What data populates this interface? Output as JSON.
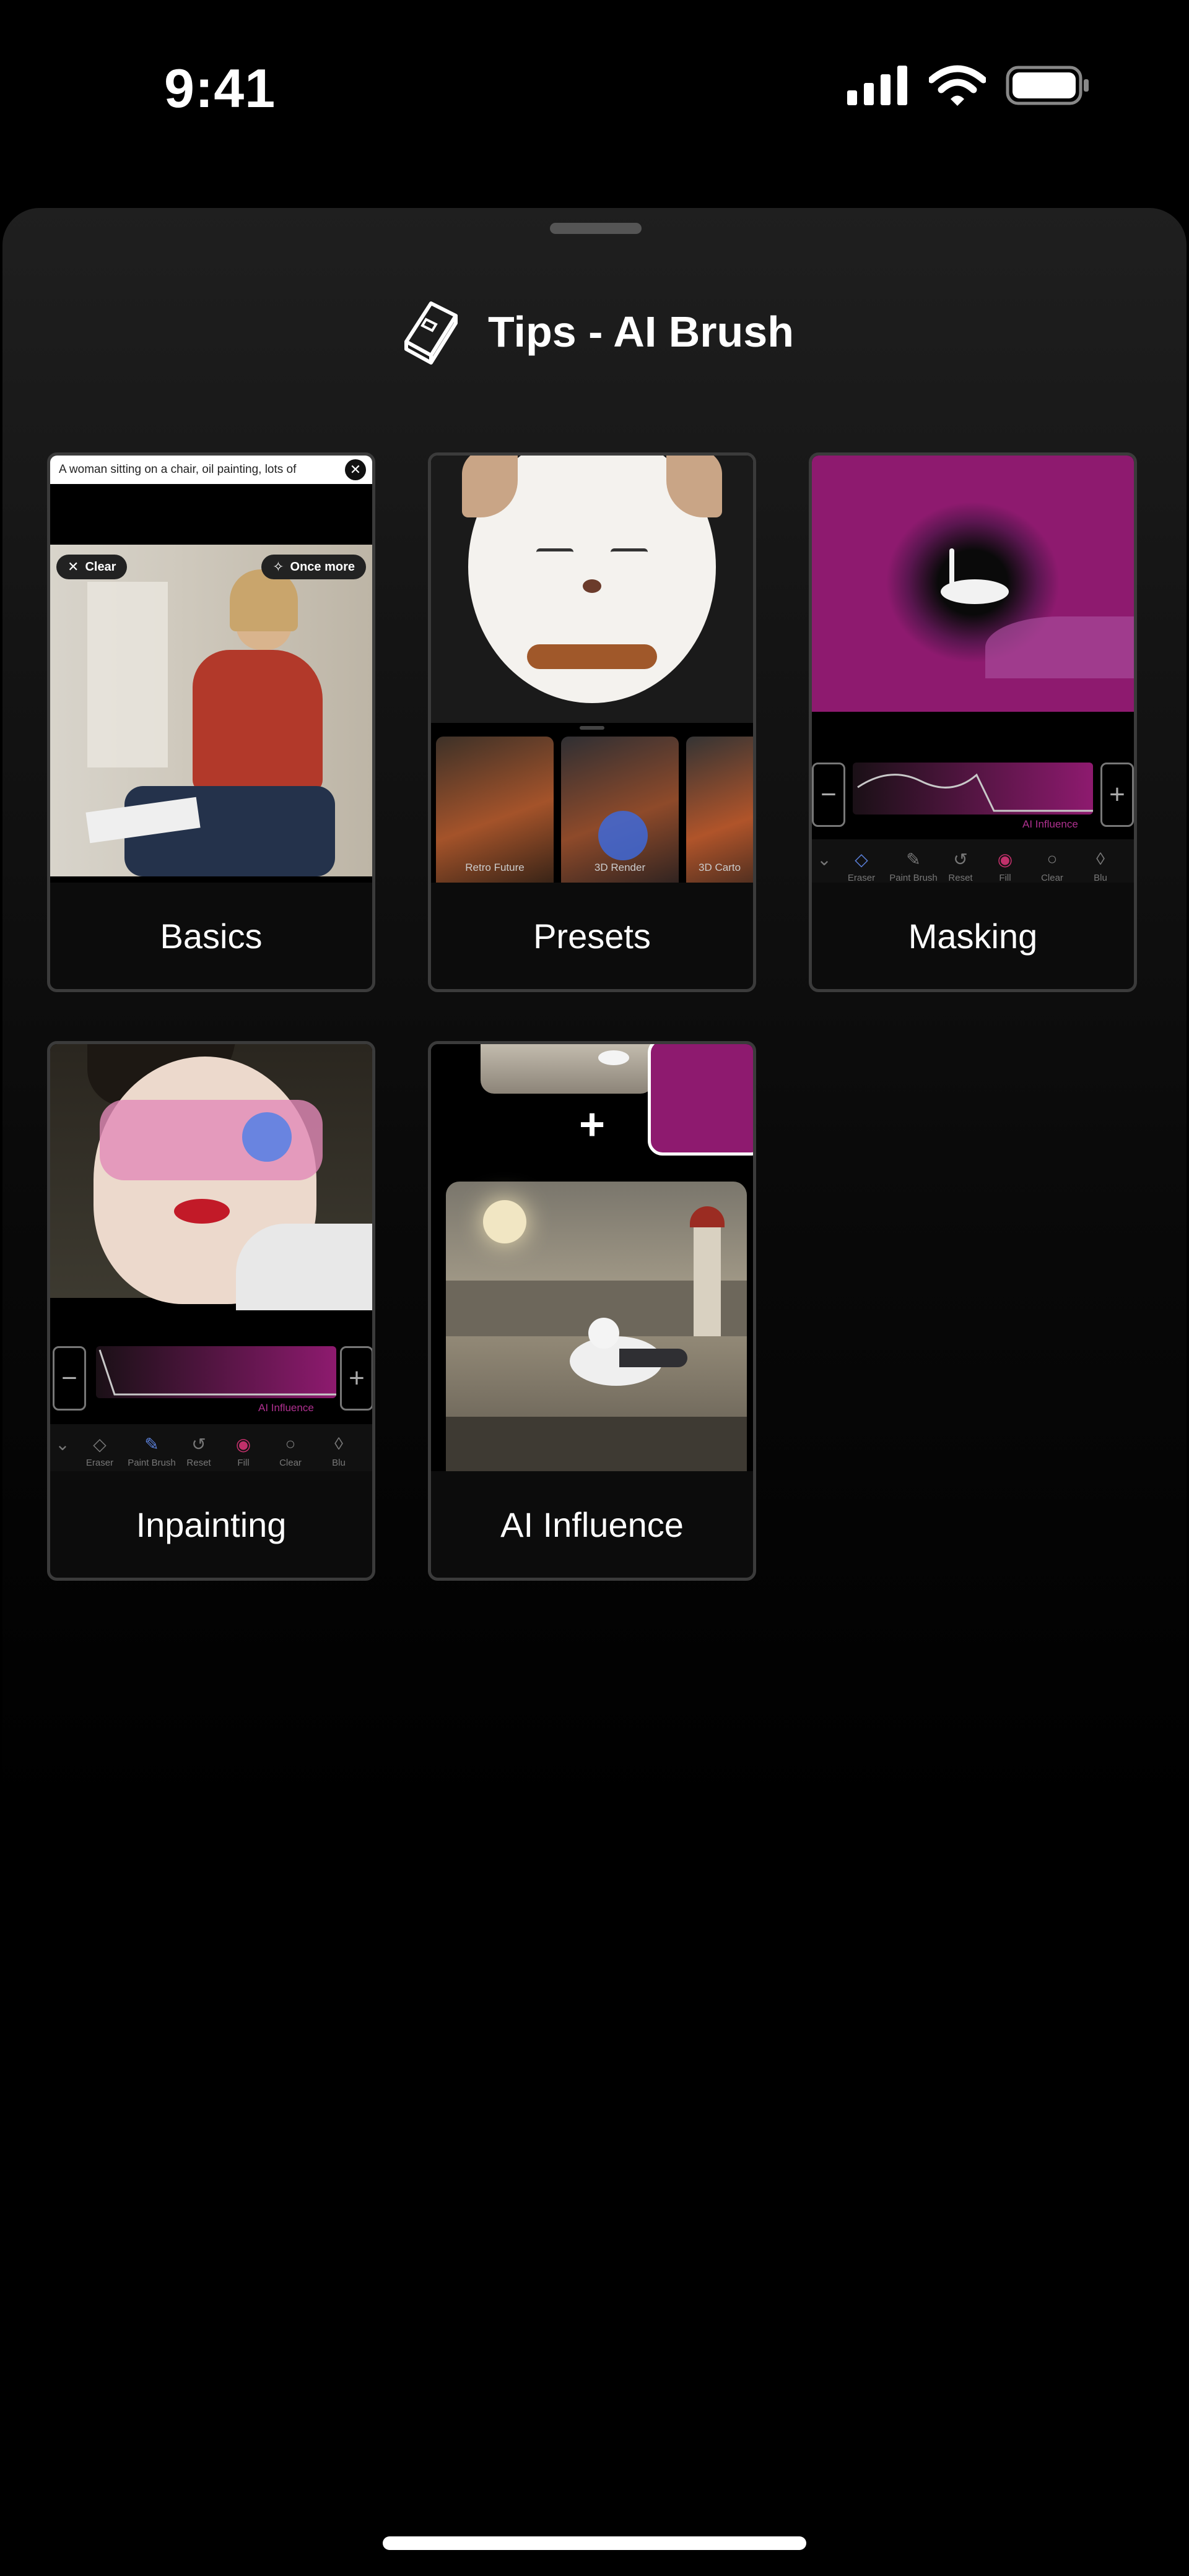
{
  "status_bar": {
    "time": "9:41"
  },
  "sheet": {
    "title": "Tips - AI Brush"
  },
  "cards": {
    "basics": {
      "label": "Basics",
      "prompt_text": "A woman sitting on a chair, oil painting, lots of",
      "clear_label": "Clear",
      "once_more_label": "Once more"
    },
    "presets": {
      "label": "Presets",
      "styles": [
        "Retro Future",
        "3D Render",
        "3D Carto"
      ]
    },
    "masking": {
      "label": "Masking",
      "influence_label": "AI Influence",
      "tools": [
        "Eraser",
        "Paint Brush",
        "Reset",
        "Fill",
        "Clear",
        "Blu"
      ]
    },
    "inpainting": {
      "label": "Inpainting",
      "influence_label": "AI Influence",
      "tools": [
        "Eraser",
        "Paint Brush",
        "Reset",
        "Fill",
        "Clear",
        "Blu"
      ]
    },
    "ai_influence": {
      "label": "AI Influence",
      "plus_sign": "+"
    }
  },
  "colors": {
    "background": "#000000",
    "sheet": "#1c1c1c",
    "card_border": "#3b3b3b",
    "accent_magenta": "#8e1a6f",
    "mask_blue": "#4a7ee8"
  },
  "icons": [
    "signal-icon",
    "wifi-icon",
    "battery-icon",
    "book-icon",
    "close-icon",
    "sparkle-icon",
    "minus-icon",
    "plus-icon",
    "chevron-down-icon",
    "eraser-icon",
    "paint-brush-icon",
    "reset-icon",
    "fill-icon",
    "clear-icon",
    "blur-icon"
  ]
}
